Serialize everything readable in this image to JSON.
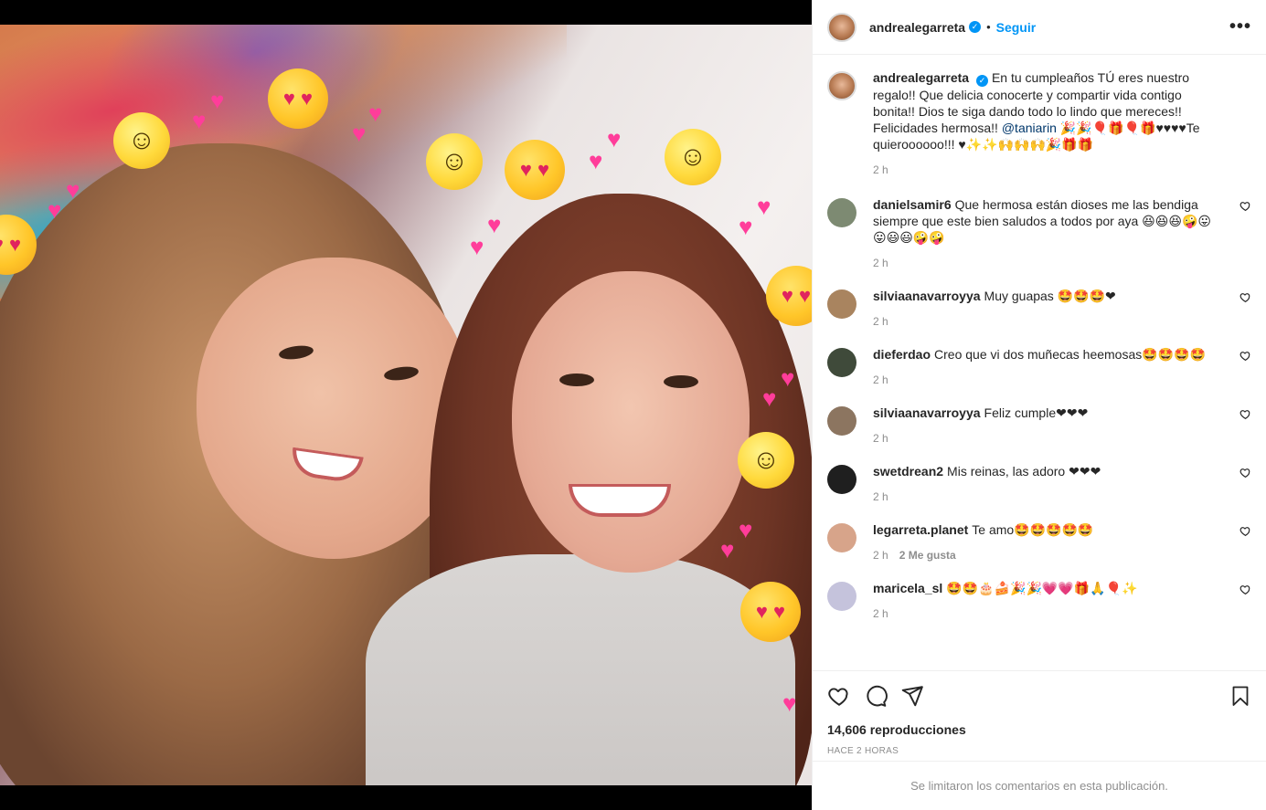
{
  "post": {
    "owner": {
      "username": "andrealegarreta",
      "verified_glyph": "✓",
      "separator": "•",
      "follow_label": "Seguir",
      "more_glyph": "•••"
    },
    "media": {
      "emojis": {
        "smile": "☺",
        "heart_eyes": "♥ ♥",
        "pink_heart": "♥"
      }
    },
    "caption": {
      "username": "andrealegarreta",
      "text_before_mention": "En tu cumpleaños TÚ eres nuestro regalo!! Que delicia conocerte y compartir vida contigo bonita!! Dios te siga dando todo lo lindo que mereces!! Felicidades hermosa!! ",
      "mention": "@taniarin",
      "text_after_mention": " 🎉🎉🎈🎁🎈🎁♥♥♥♥Te quieroooooo!!! ♥✨✨🙌🙌🙌🎉🎁🎁",
      "time": "2 h"
    },
    "comments": [
      {
        "username": "danielsamir6",
        "text": "Que hermosa están dioses me las bendiga siempre que este bien saludos a todos por aya 😆😆😆🤪😛😛😃😃🤪🤪",
        "time": "2 h",
        "likes": ""
      },
      {
        "username": "silviaanavarroyya",
        "text": "Muy guapas 🤩🤩🤩❤",
        "time": "2 h",
        "likes": ""
      },
      {
        "username": "dieferdao",
        "text": "Creo que vi dos muñecas heemosas🤩🤩🤩🤩",
        "time": "2 h",
        "likes": ""
      },
      {
        "username": "silviaanavarroyya",
        "text": "Feliz cumple❤❤❤",
        "time": "2 h",
        "likes": ""
      },
      {
        "username": "swetdrean2",
        "text": "Mis reinas, las adoro ❤❤❤",
        "time": "2 h",
        "likes": ""
      },
      {
        "username": "legarreta.planet",
        "text": "Te amo🤩🤩🤩🤩🤩",
        "time": "2 h",
        "likes": "2 Me gusta"
      },
      {
        "username": "maricela_sl",
        "text": "🤩🤩🎂🍰🎉🎉💗💗🎁🙏🎈✨",
        "time": "2 h",
        "likes": ""
      }
    ],
    "stats": {
      "views": "14,606 reproducciones",
      "posted": "HACE 2 HORAS"
    },
    "footer": {
      "limited_notice": "Se limitaron los comentarios en esta publicación."
    },
    "colors": {
      "accent": "#0095f6",
      "muted": "#8e8e8e",
      "text": "#262626",
      "border": "#efefef"
    },
    "icons": [
      "heart-icon",
      "comment-icon",
      "share-icon",
      "bookmark-icon",
      "more-icon",
      "verified-icon"
    ]
  }
}
